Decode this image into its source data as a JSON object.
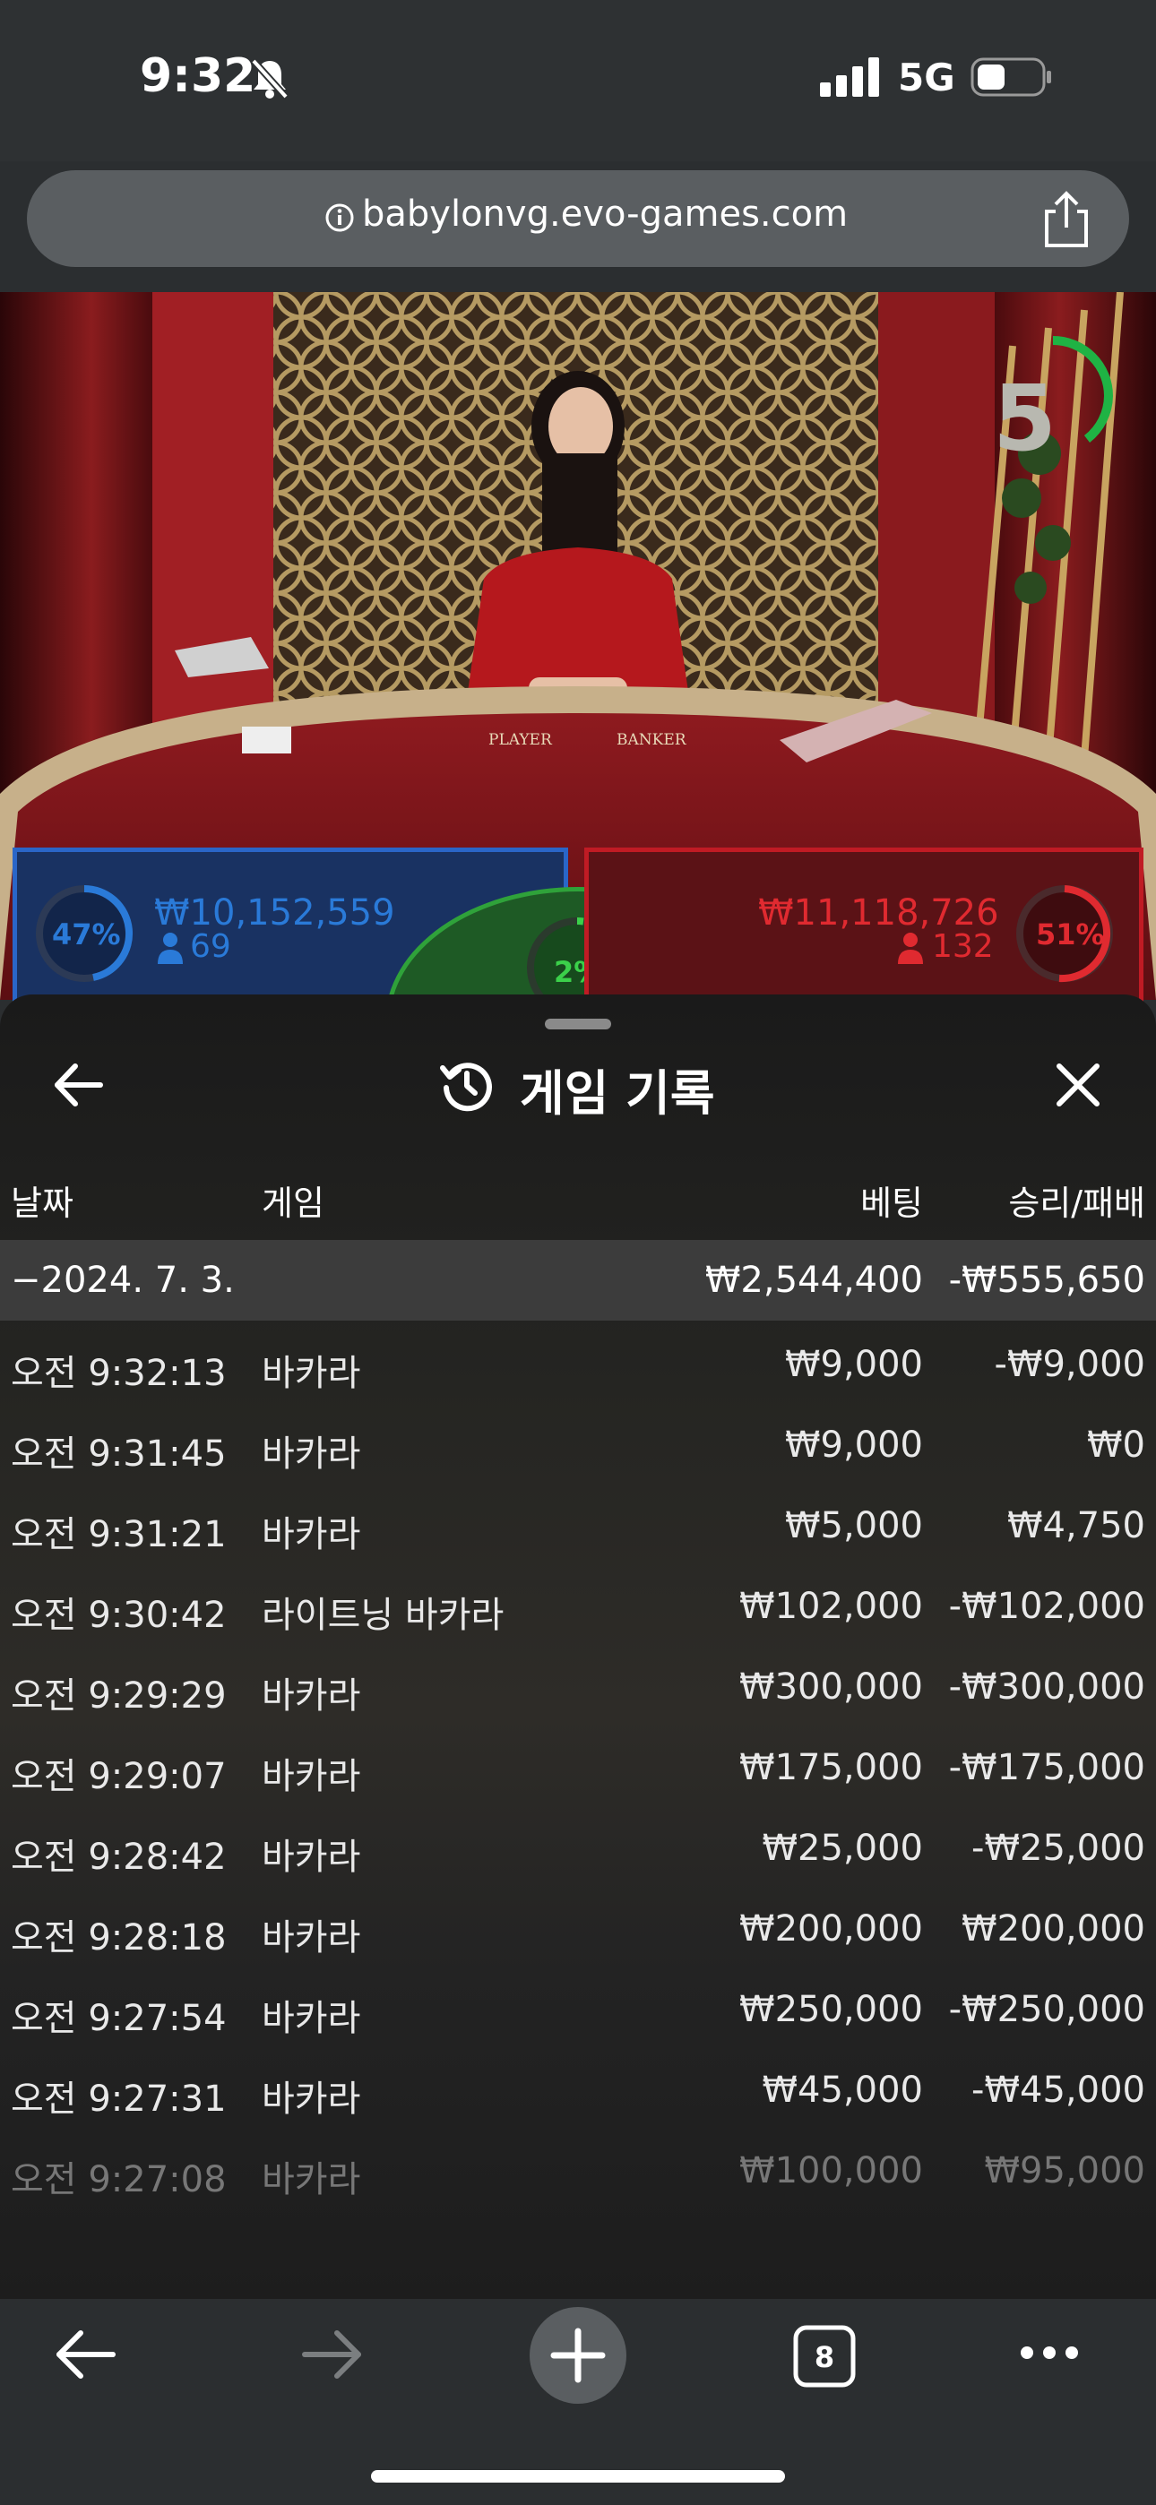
{
  "status_bar": {
    "time": "9:32",
    "network": "5G"
  },
  "browser": {
    "url": "babylonvg.evo-games.com"
  },
  "game": {
    "countdown": "5",
    "table_labels": {
      "player": "PLAYER",
      "banker": "BANKER"
    },
    "player": {
      "percent": "47%",
      "amount": "₩10,152,559",
      "count": "69"
    },
    "tie": {
      "percent": "2%"
    },
    "banker": {
      "percent": "51%",
      "amount": "₩11,118,726",
      "count": "132"
    }
  },
  "history": {
    "title": "게임 기록",
    "columns": {
      "date": "날짜",
      "game": "게임",
      "bet": "베팅",
      "result": "승리/패배"
    },
    "date_group": {
      "date": "−2024. 7. 3.",
      "total_bet": "₩2,544,400",
      "total_result": "-₩555,650"
    },
    "rows": [
      {
        "time": "오전 9:32:13",
        "game": "바카라",
        "bet": "₩9,000",
        "result": "-₩9,000"
      },
      {
        "time": "오전 9:31:45",
        "game": "바카라",
        "bet": "₩9,000",
        "result": "₩0"
      },
      {
        "time": "오전 9:31:21",
        "game": "바카라",
        "bet": "₩5,000",
        "result": "₩4,750"
      },
      {
        "time": "오전 9:30:42",
        "game": "라이트닝 바카라",
        "bet": "₩102,000",
        "result": "-₩102,000"
      },
      {
        "time": "오전 9:29:29",
        "game": "바카라",
        "bet": "₩300,000",
        "result": "-₩300,000"
      },
      {
        "time": "오전 9:29:07",
        "game": "바카라",
        "bet": "₩175,000",
        "result": "-₩175,000"
      },
      {
        "time": "오전 9:28:42",
        "game": "바카라",
        "bet": "₩25,000",
        "result": "-₩25,000"
      },
      {
        "time": "오전 9:28:18",
        "game": "바카라",
        "bet": "₩200,000",
        "result": "₩200,000"
      },
      {
        "time": "오전 9:27:54",
        "game": "바카라",
        "bet": "₩250,000",
        "result": "-₩250,000"
      },
      {
        "time": "오전 9:27:31",
        "game": "바카라",
        "bet": "₩45,000",
        "result": "-₩45,000"
      },
      {
        "time": "오전 9:27:08",
        "game": "바카라",
        "bet": "₩100,000",
        "result": "₩95,000"
      }
    ]
  },
  "toolbar": {
    "tab_count": "8"
  },
  "colors": {
    "player_blue": "#2a66c8",
    "banker_red": "#c01b24",
    "tie_green": "#2fa23a"
  }
}
